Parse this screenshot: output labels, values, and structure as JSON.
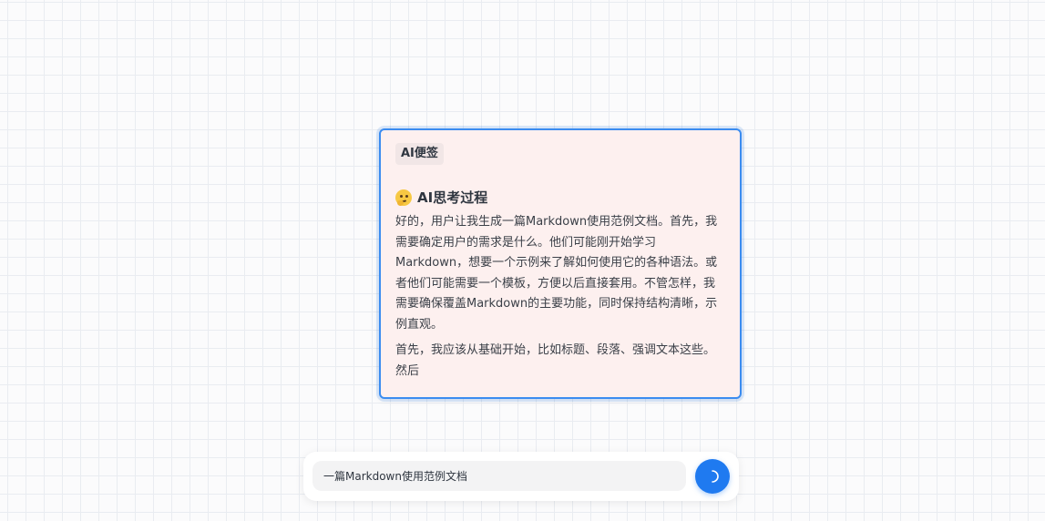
{
  "note": {
    "tag": "AI便签",
    "thinking": {
      "icon": "thinking-face-icon",
      "title": "AI思考过程",
      "paragraphs": [
        "好的，用户让我生成一篇Markdown使用范例文档。首先，我需要确定用户的需求是什么。他们可能刚开始学习Markdown，想要一个示例来了解如何使用它的各种语法。或者他们可能需要一个模板，方便以后直接套用。不管怎样，我需要确保覆盖Markdown的主要功能，同时保持结构清晰，示例直观。",
        "首先，我应该从基础开始，比如标题、段落、强调文本这些。然后"
      ]
    }
  },
  "composer": {
    "value": "一篇Markdown使用范例文档",
    "send_icon": "loading-spinner-icon"
  },
  "colors": {
    "accent": "#1f7af0",
    "note_background": "#fdf0ef",
    "note_border": "#3b8cf0"
  }
}
